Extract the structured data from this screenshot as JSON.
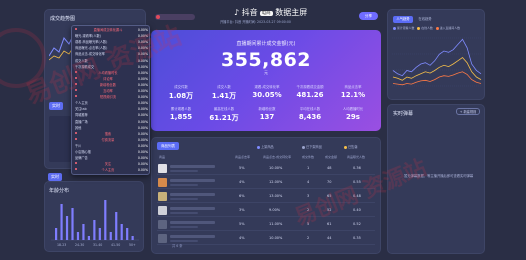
{
  "header": {
    "brand": "抖音",
    "badge": "电商",
    "title": "数据主屏",
    "subtitle": "开播平台: 抖音     开播时间: 2023-03-27 09:00:00",
    "share_label": "分享"
  },
  "left_panel": {
    "title": "成交趋势图",
    "chip_label": "实时"
  },
  "dropdown": {
    "rows": [
      {
        "label": "直播间成交转化漏斗",
        "value": "0.00%",
        "cat": true
      },
      {
        "label": "曝光-观看率(人数)",
        "value": "0.00%",
        "cat": false
      },
      {
        "label": "观看-商品曝光率(人数)",
        "value": "0.00%",
        "cat": false
      },
      {
        "label": "商品曝光-点击率(人数)",
        "value": "0.00%",
        "cat": false
      },
      {
        "label": "商品点击-成交转化率",
        "value": "0.00%",
        "cat": false
      },
      {
        "label": "成交人数",
        "value": "0.00%",
        "cat": false
      },
      {
        "label": "千次观看成交",
        "value": "0.00%",
        "cat": false
      },
      {
        "label": "人均看播时长",
        "value": "0.00%",
        "cat": true
      },
      {
        "label": "评论率",
        "value": "0.00%",
        "cat": true
      },
      {
        "label": "新增粉丝数",
        "value": "0.00%",
        "cat": true
      },
      {
        "label": "互动率",
        "value": "0.00%",
        "cat": true
      },
      {
        "label": "短视频引流",
        "value": "0.00%",
        "cat": true
      },
      {
        "label": "个人主页",
        "value": "0.00%",
        "cat": false
      },
      {
        "label": "关注tab",
        "value": "0.00%",
        "cat": false
      },
      {
        "label": "同城推荐",
        "value": "0.00%",
        "cat": false
      },
      {
        "label": "直播广场",
        "value": "0.00%",
        "cat": false
      },
      {
        "label": "其他",
        "value": "0.00%",
        "cat": false
      },
      {
        "label": "搜索",
        "value": "0.00%",
        "cat": true
      },
      {
        "label": "付费流量",
        "value": "0.00%",
        "cat": true
      },
      {
        "label": "千川",
        "value": "0.00%",
        "cat": false
      },
      {
        "label": "小店随心推",
        "value": "0.00%",
        "cat": false
      },
      {
        "label": "品牌广告",
        "value": "0.00%",
        "cat": false
      },
      {
        "label": "关注",
        "value": "0.00%",
        "cat": true
      },
      {
        "label": "个人主页",
        "value": "0.00%",
        "cat": true
      }
    ]
  },
  "age_panel": {
    "title": "年龄分布",
    "ticks": [
      "18-23",
      "24-30",
      "31-40",
      "41-50",
      "50+"
    ],
    "chart_data": {
      "type": "bar",
      "categories": [
        "18-23",
        "24-30",
        "31-40",
        "41-50",
        "50+"
      ],
      "values": [
        3,
        9,
        6,
        8,
        2,
        4,
        1,
        5,
        3,
        10,
        2,
        7,
        4,
        3,
        1
      ],
      "ylim": [
        0,
        10
      ]
    }
  },
  "hero": {
    "title": "直播期间累计成交金额(元)",
    "number": "355,862",
    "unit": "元",
    "metrics": [
      {
        "label": "成交件数",
        "value": "1.08万"
      },
      {
        "label": "成交人数",
        "value": "1.41万"
      },
      {
        "label": "观看-成交转化率",
        "value": "30.05%"
      },
      {
        "label": "千次观看成交金额",
        "value": "481.26"
      },
      {
        "label": "商品点击率",
        "value": "12.1%"
      },
      {
        "label": "累计观看人数",
        "value": "1,855"
      },
      {
        "label": "最高在线人数",
        "value": "61.21万"
      },
      {
        "label": "新增粉丝数",
        "value": "137"
      },
      {
        "label": "平均在线人数",
        "value": "8,436"
      },
      {
        "label": "人均看播时长",
        "value": "29s"
      }
    ]
  },
  "products": {
    "tab_label": "商品列表",
    "legend_a": "上架商品",
    "legend_b": "已下架商品",
    "legend_c": "已售罄",
    "headers": [
      "商品",
      "商品点击率",
      "商品点击-成交转化率",
      "成交件数",
      "成交金额",
      "商品曝光人数"
    ],
    "rows": [
      {
        "thumb": "#e0e0e6",
        "c1": "5%",
        "c2": "10.00%",
        "c3": "1",
        "c4": "48",
        "c5": "0.36"
      },
      {
        "thumb": "#d68a4b",
        "c1": "4%",
        "c2": "12.00%",
        "c3": "4",
        "c4": "70",
        "c5": "0.55"
      },
      {
        "thumb": "#c9b27a",
        "c1": "6%",
        "c2": "13.00%",
        "c3": "3",
        "c4": "65",
        "c5": "0.48"
      },
      {
        "thumb": "#cfd0d8",
        "c1": "3%",
        "c2": "9.00%",
        "c3": "2",
        "c4": "52",
        "c5": "0.40"
      },
      {
        "thumb": "#5d6480",
        "c1": "5%",
        "c2": "11.00%",
        "c3": "5",
        "c4": "61",
        "c5": "0.52"
      },
      {
        "thumb": "#5d6480",
        "c1": "4%",
        "c2": "10.00%",
        "c3": "2",
        "c4": "44",
        "c5": "0.35"
      }
    ],
    "pager": "共 6 条"
  },
  "right_top": {
    "tab1": "人气趋势",
    "tab2": "在线趋势",
    "legend": [
      "累计观看人数",
      "在线人数",
      "进入直播间人数"
    ],
    "colors": [
      "#7f8bff",
      "#f7c04a",
      "#ff7a45"
    ],
    "chart_data": {
      "type": "line",
      "series": [
        {
          "values": [
            30,
            25,
            22,
            30,
            28,
            35,
            40,
            42,
            38,
            45,
            55,
            60,
            58,
            62,
            70,
            78,
            65,
            40,
            30,
            25
          ]
        },
        {
          "values": [
            20,
            18,
            15,
            20,
            18,
            22,
            25,
            28,
            26,
            30,
            35,
            38,
            36,
            40,
            45,
            50,
            42,
            28,
            20,
            16
          ]
        },
        {
          "values": [
            10,
            9,
            8,
            10,
            9,
            12,
            14,
            15,
            13,
            16,
            20,
            22,
            21,
            23,
            26,
            28,
            24,
            16,
            12,
            10
          ]
        }
      ],
      "ylim": [
        0,
        80
      ]
    }
  },
  "right_bottom": {
    "title": "实时弹幕",
    "add_label": "+ 新建规则",
    "empty_text": "暂无弹幕数据，等主播开播后即可查看实时弹幕"
  },
  "watermark": {
    "text1": "易创网 资源站",
    "text2": "易创网 资源站"
  }
}
